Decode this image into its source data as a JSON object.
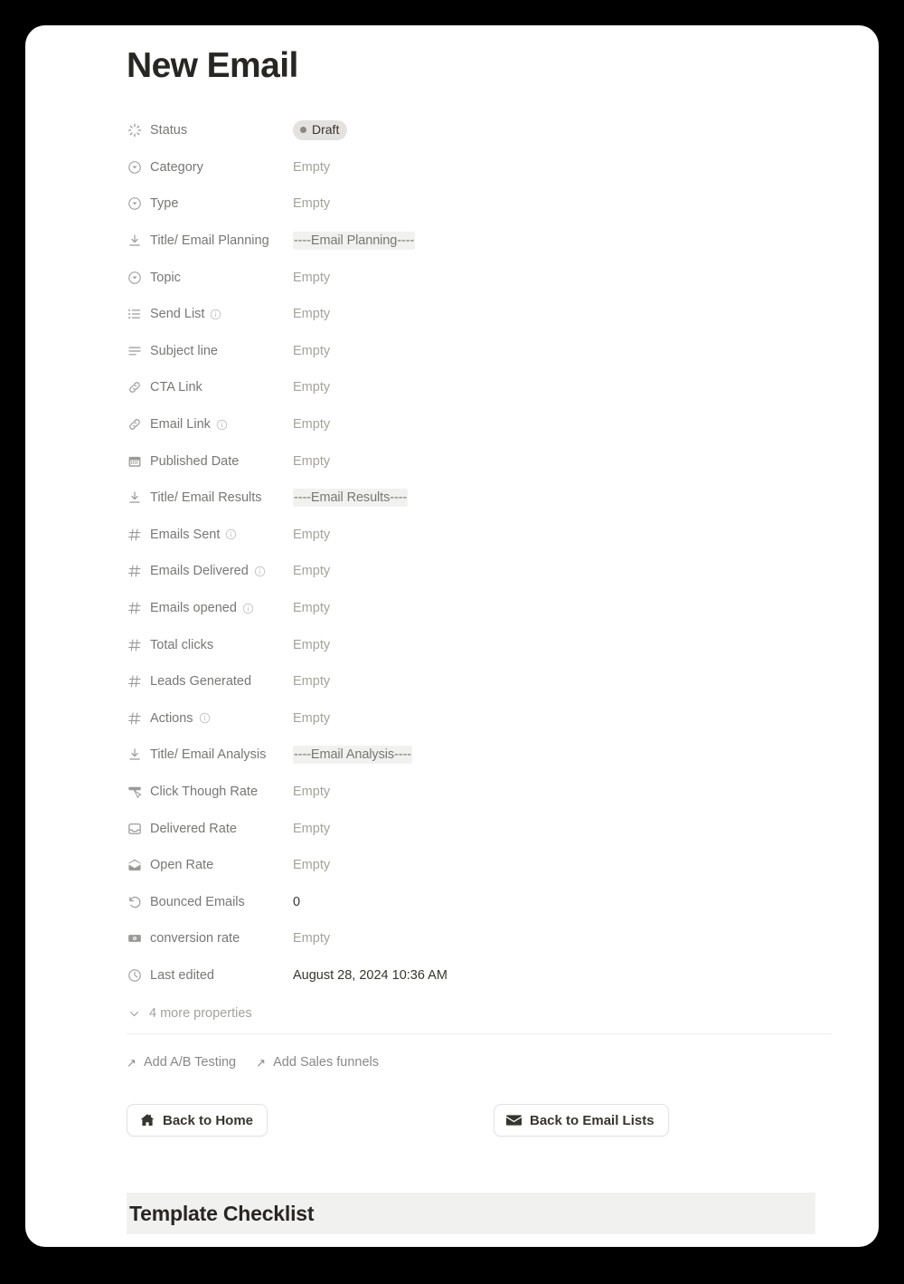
{
  "page": {
    "title": "New Email"
  },
  "properties": [
    {
      "icon": "spinner-icon",
      "label": "Status",
      "info": false,
      "value": "Draft",
      "kind": "status"
    },
    {
      "icon": "select-circle-icon",
      "label": "Category",
      "info": false,
      "value": "Empty",
      "kind": "empty"
    },
    {
      "icon": "select-circle-icon",
      "label": "Type",
      "info": false,
      "value": "Empty",
      "kind": "empty"
    },
    {
      "icon": "download-icon",
      "label": "Title/ Email Planning",
      "info": false,
      "value": "----Email Planning----",
      "kind": "highlight"
    },
    {
      "icon": "select-circle-icon",
      "label": "Topic",
      "info": false,
      "value": "Empty",
      "kind": "empty"
    },
    {
      "icon": "multi-select-icon",
      "label": "Send List",
      "info": true,
      "value": "Empty",
      "kind": "empty"
    },
    {
      "icon": "text-lines-icon",
      "label": "Subject line",
      "info": false,
      "value": "Empty",
      "kind": "empty"
    },
    {
      "icon": "link-icon",
      "label": "CTA Link",
      "info": false,
      "value": "Empty",
      "kind": "empty"
    },
    {
      "icon": "link-icon",
      "label": "Email Link",
      "info": true,
      "value": "Empty",
      "kind": "empty"
    },
    {
      "icon": "calendar-icon",
      "label": "Published Date",
      "info": false,
      "value": "Empty",
      "kind": "empty"
    },
    {
      "icon": "download-icon",
      "label": "Title/ Email Results",
      "info": false,
      "value": "----Email Results----",
      "kind": "highlight"
    },
    {
      "icon": "number-hash-icon",
      "label": "Emails Sent",
      "info": true,
      "value": "Empty",
      "kind": "empty"
    },
    {
      "icon": "number-hash-icon",
      "label": "Emails Delivered",
      "info": true,
      "value": "Empty",
      "kind": "empty"
    },
    {
      "icon": "number-hash-icon",
      "label": "Emails opened",
      "info": true,
      "value": "Empty",
      "kind": "empty"
    },
    {
      "icon": "number-hash-icon",
      "label": "Total clicks",
      "info": false,
      "value": "Empty",
      "kind": "empty"
    },
    {
      "icon": "number-hash-icon",
      "label": "Leads Generated",
      "info": false,
      "value": "Empty",
      "kind": "empty"
    },
    {
      "icon": "number-hash-icon",
      "label": "Actions",
      "info": true,
      "value": "Empty",
      "kind": "empty"
    },
    {
      "icon": "download-icon",
      "label": "Title/ Email Analysis",
      "info": false,
      "value": "----Email Analysis----",
      "kind": "highlight"
    },
    {
      "icon": "cursor-click-icon",
      "label": "Click Though Rate",
      "info": false,
      "value": "Empty",
      "kind": "empty"
    },
    {
      "icon": "inbox-icon",
      "label": "Delivered Rate",
      "info": false,
      "value": "Empty",
      "kind": "empty"
    },
    {
      "icon": "open-envelope-icon",
      "label": "Open Rate",
      "info": false,
      "value": "Empty",
      "kind": "empty"
    },
    {
      "icon": "undo-arrow-icon",
      "label": "Bounced Emails",
      "info": false,
      "value": "0",
      "kind": "text"
    },
    {
      "icon": "money-icon",
      "label": "conversion rate",
      "info": false,
      "value": "Empty",
      "kind": "empty"
    },
    {
      "icon": "clock-icon",
      "label": "Last edited",
      "info": false,
      "value": "August 28, 2024 10:36 AM",
      "kind": "text"
    }
  ],
  "more_properties": {
    "label": "4 more properties",
    "icon": "chevron-down-icon"
  },
  "add_links": [
    {
      "icon": "arrow-up-right-icon",
      "label": "Add A/B Testing"
    },
    {
      "icon": "arrow-up-right-icon",
      "label": "Add Sales funnels"
    }
  ],
  "buttons": [
    {
      "icon": "home-icon",
      "label": "Back to Home"
    },
    {
      "icon": "envelope-icon",
      "label": "Back to Email Lists"
    }
  ],
  "checklist": {
    "title": "Template Checklist"
  },
  "colors": {
    "page_background": "#ffffff",
    "frame": "#000000",
    "text_primary": "#37352f",
    "text_muted": "#787774",
    "text_placeholder": "#a5a29c",
    "highlight_background": "#f1f1ef",
    "pill_background": "#e3e2e0",
    "divider": "#ededec"
  }
}
